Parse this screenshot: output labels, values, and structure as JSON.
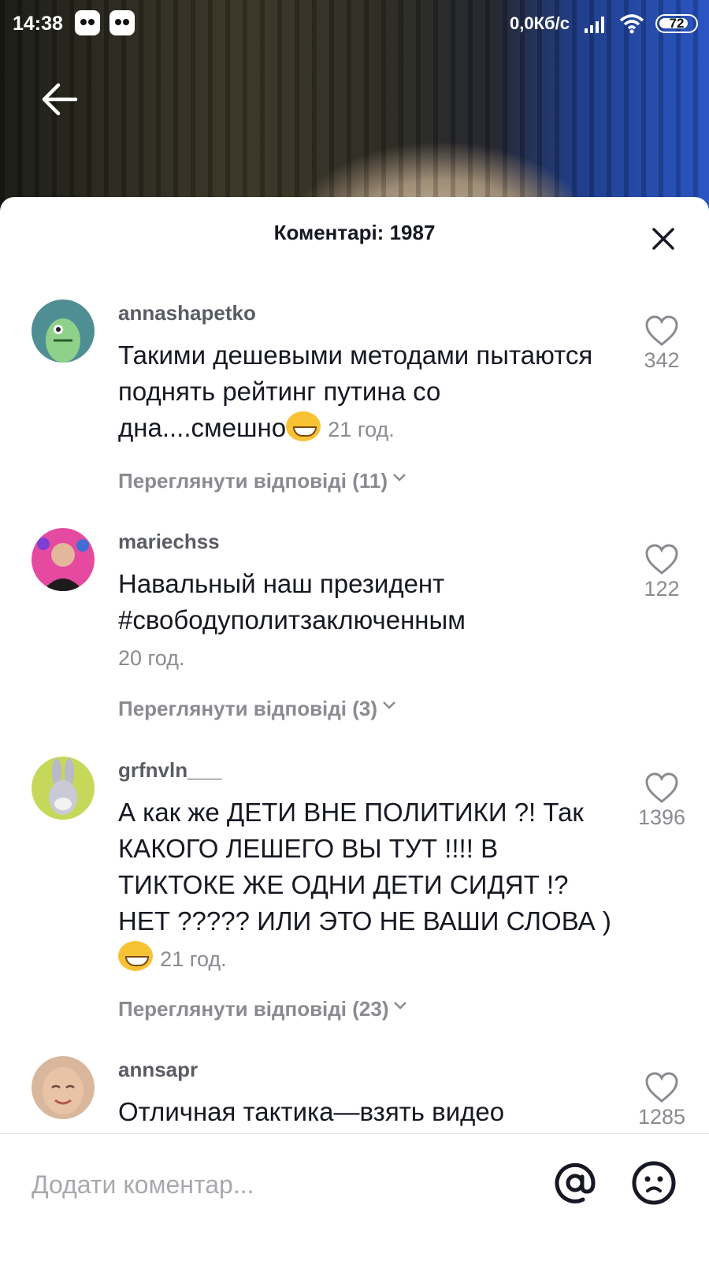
{
  "status_bar": {
    "time": "14:38",
    "net_speed": "0,0Кб/с",
    "battery": "72"
  },
  "header": {
    "title": "Коментарі: 1987"
  },
  "comments": [
    {
      "username": "annashapetko",
      "text": "Такими дешевыми методами пытаются поднять рейтинг путина со дна....смешно",
      "emoji": "grinning-face",
      "age": "21 год.",
      "replies": "Переглянути відповіді (11)",
      "likes": "342"
    },
    {
      "username": "mariechss",
      "text": "Навальный наш президент #свободуполитзаключенным",
      "age": "20 год.",
      "replies": "Переглянути відповіді (3)",
      "likes": "122"
    },
    {
      "username": "grfnvln___",
      "text": "А как же ДЕТИ ВНЕ ПОЛИТИКИ ?! Так КАКОГО ЛЕШЕГО ВЫ ТУТ !!!! В ТИКТОКЕ ЖЕ ОДНИ ДЕТИ СИДЯТ !? НЕТ ????? ИЛИ ЭТО НЕ ВАШИ СЛОВА )",
      "emoji": "smirking-face",
      "age": "21 год.",
      "replies": "Переглянути відповіді (23)",
      "likes": "1396"
    },
    {
      "username": "annsapr",
      "text": "Отличная тактика—взять видео",
      "likes": "1285"
    }
  ],
  "input": {
    "placeholder": "Додати коментар..."
  },
  "colors": {
    "primary_text": "#161823",
    "secondary_text": "#8a8b91",
    "emoji_yellow": "#f7c233"
  }
}
